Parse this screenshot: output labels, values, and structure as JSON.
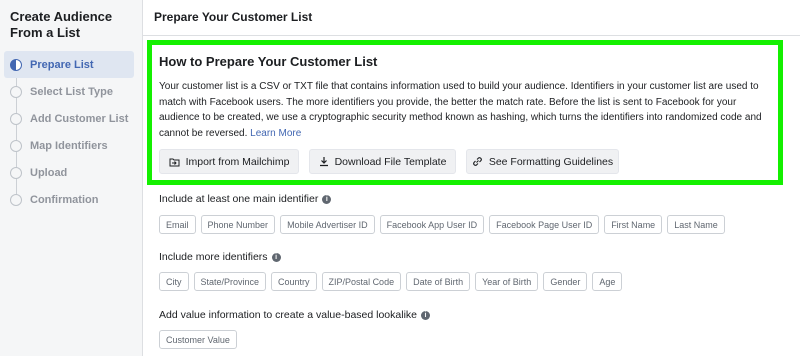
{
  "sidebar": {
    "title": "Create Audience From a List",
    "steps": [
      {
        "label": "Prepare List",
        "active": true
      },
      {
        "label": "Select List Type"
      },
      {
        "label": "Add Customer List"
      },
      {
        "label": "Map Identifiers"
      },
      {
        "label": "Upload"
      },
      {
        "label": "Confirmation"
      }
    ]
  },
  "header": {
    "title": "Prepare Your Customer List"
  },
  "card": {
    "title": "How to Prepare Your Customer List",
    "body": "Your customer list is a CSV or TXT file that contains information used to build your audience. Identifiers in your customer list are used to match with Facebook users. The more identifiers you provide, the better the match rate. Before the list is sent to Facebook for your audience to be created, we use a cryptographic security method known as hashing, which turns the identifiers into randomized code and cannot be reversed.",
    "learn_more": "Learn More",
    "buttons": {
      "import": "Import from Mailchimp",
      "download": "Download File Template",
      "formatting": "See Formatting Guidelines"
    }
  },
  "sections": {
    "main": {
      "label": "Include at least one main identifier",
      "chips": [
        "Email",
        "Phone Number",
        "Mobile Advertiser ID",
        "Facebook App User ID",
        "Facebook Page User ID",
        "First Name",
        "Last Name"
      ]
    },
    "more": {
      "label": "Include more identifiers",
      "chips": [
        "City",
        "State/Province",
        "Country",
        "ZIP/Postal Code",
        "Date of Birth",
        "Year of Birth",
        "Gender",
        "Age"
      ]
    },
    "value": {
      "label": "Add value information to create a value-based lookalike",
      "chips": [
        "Customer Value"
      ]
    }
  },
  "colors": {
    "accent": "#4267b2",
    "highlight": "#14f000"
  }
}
